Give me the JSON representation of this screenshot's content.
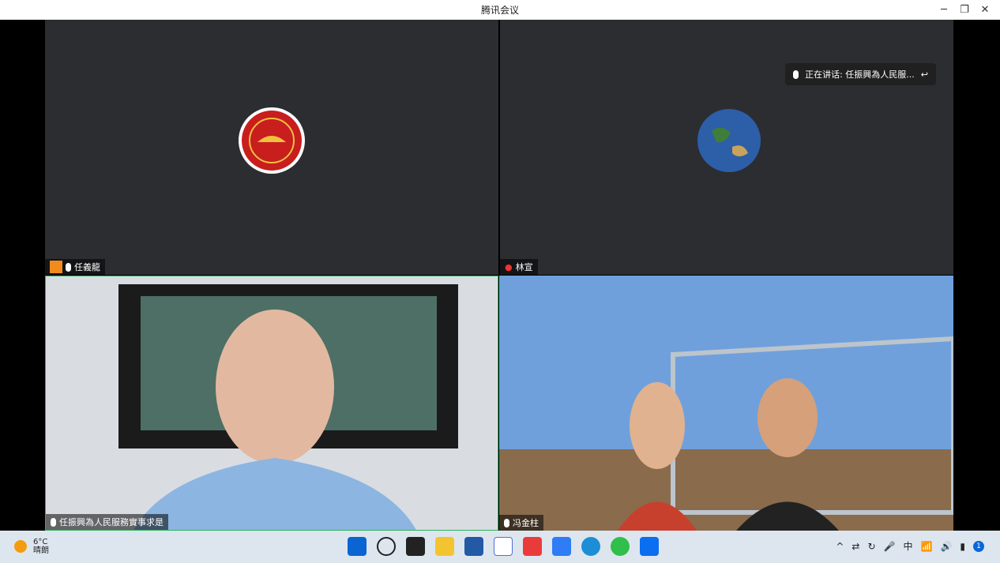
{
  "window": {
    "title": "腾讯会议",
    "controls": [
      "minimize-icon",
      "restore-icon",
      "close-icon"
    ]
  },
  "speaking_indicator": {
    "label": "正在讲话: 任振興為人民服..."
  },
  "participants": [
    {
      "name": "任義龍",
      "mic": "mic-icon",
      "avatar": "red-seal-avatar"
    },
    {
      "name": "林宣",
      "mic": "none",
      "avatar": "earth-avatar"
    },
    {
      "name": "任振興為人民服務實事求是",
      "mic": "mic-icon",
      "video": "man-in-office"
    },
    {
      "name": "冯金柱",
      "mic": "mic-icon",
      "video": "couple-outdoors"
    }
  ],
  "taskbar": {
    "weather": {
      "temp": "6°C",
      "desc": "晴朗"
    },
    "tray_ime": "中",
    "notification_count": "1"
  },
  "colors": {
    "active_border": "#29b35c",
    "tile_bg": "#2b2d31"
  }
}
